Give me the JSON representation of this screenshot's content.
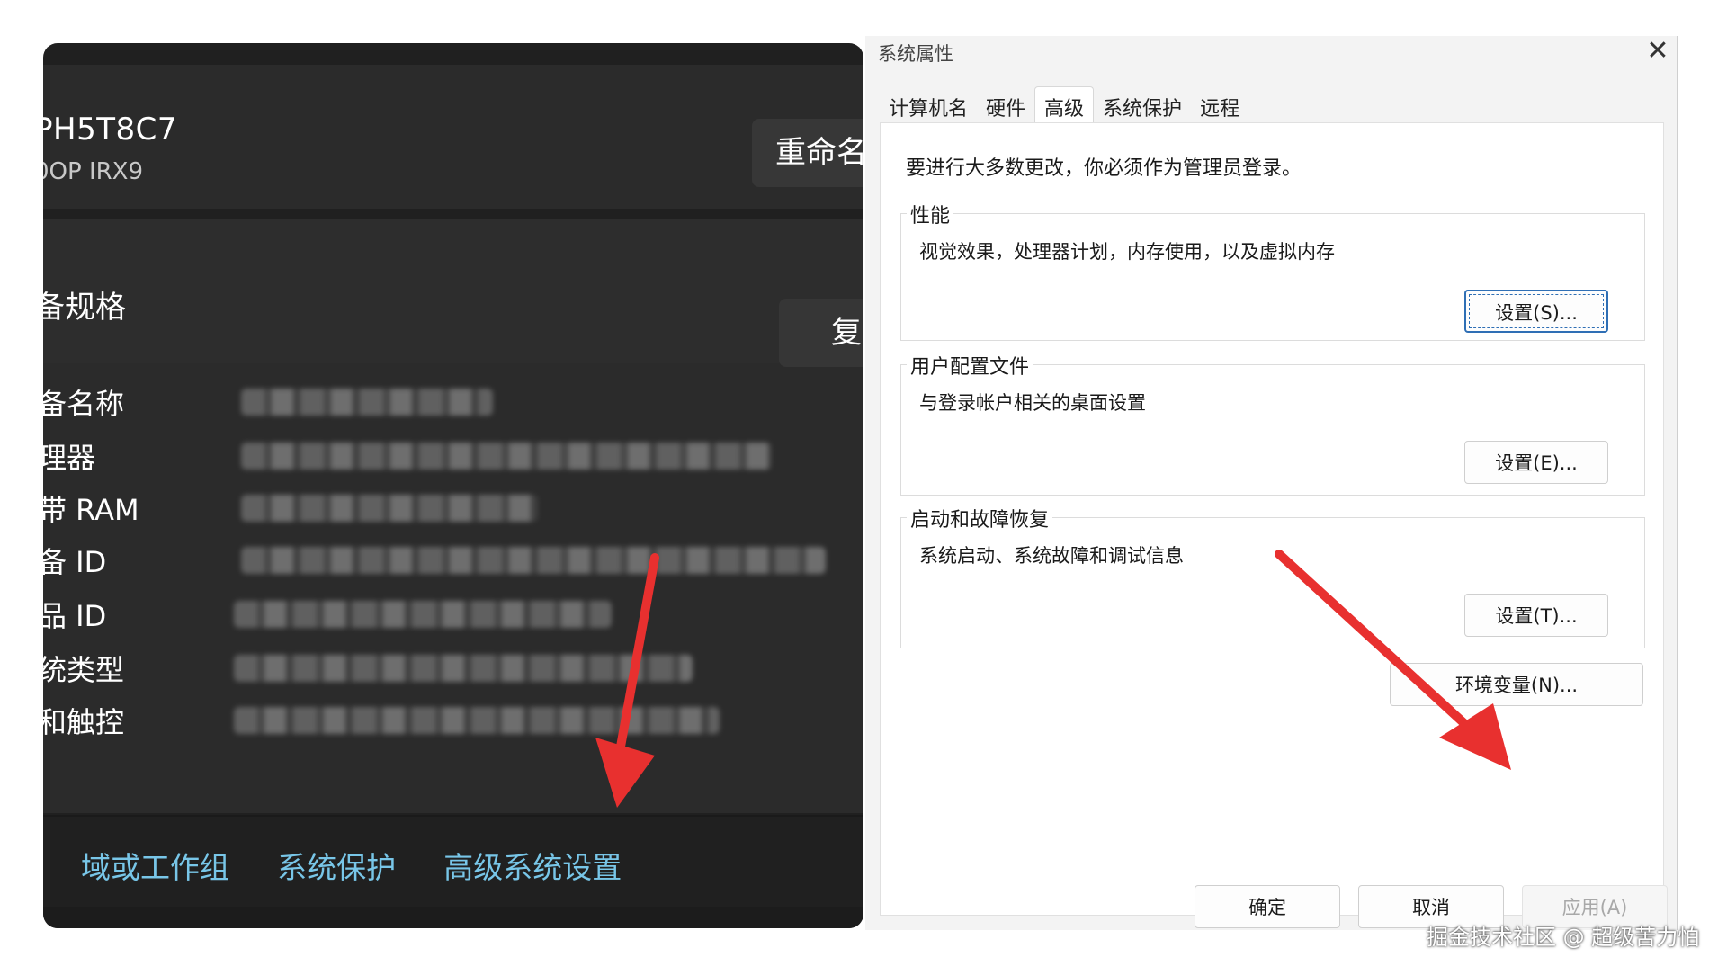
{
  "settings_panel": {
    "device_name": "PH5T8C7",
    "device_model": "0OP IRX9",
    "rename_button": "重命名",
    "specs_title": "备规格",
    "copy_button": "复",
    "specs": [
      {
        "label": "备名称"
      },
      {
        "label": "理器"
      },
      {
        "label": "带 RAM"
      },
      {
        "label": "备 ID"
      },
      {
        "label": "品 ID"
      },
      {
        "label": "统类型"
      },
      {
        "label": "和触控"
      }
    ],
    "related_links": [
      "域或工作组",
      "系统保护",
      "高级系统设置"
    ]
  },
  "dialog": {
    "title": "系统属性",
    "tabs": [
      "计算机名",
      "硬件",
      "高级",
      "系统保护",
      "远程"
    ],
    "active_tab": "高级",
    "admin_note": "要进行大多数更改，你必须作为管理员登录。",
    "groups": {
      "performance": {
        "title": "性能",
        "description": "视觉效果，处理器计划，内存使用，以及虚拟内存",
        "button": "设置(S)..."
      },
      "user_profiles": {
        "title": "用户配置文件",
        "description": "与登录帐户相关的桌面设置",
        "button": "设置(E)..."
      },
      "startup_recovery": {
        "title": "启动和故障恢复",
        "description": "系统启动、系统故障和调试信息",
        "button": "设置(T)..."
      }
    },
    "env_button": "环境变量(N)...",
    "ok_button": "确定",
    "cancel_button": "取消",
    "apply_button": "应用(A)"
  },
  "watermark": "掘金技术社区 @ 超级苦力怕",
  "annotation_color": "#e8302f",
  "link_color": "#78c6e8"
}
